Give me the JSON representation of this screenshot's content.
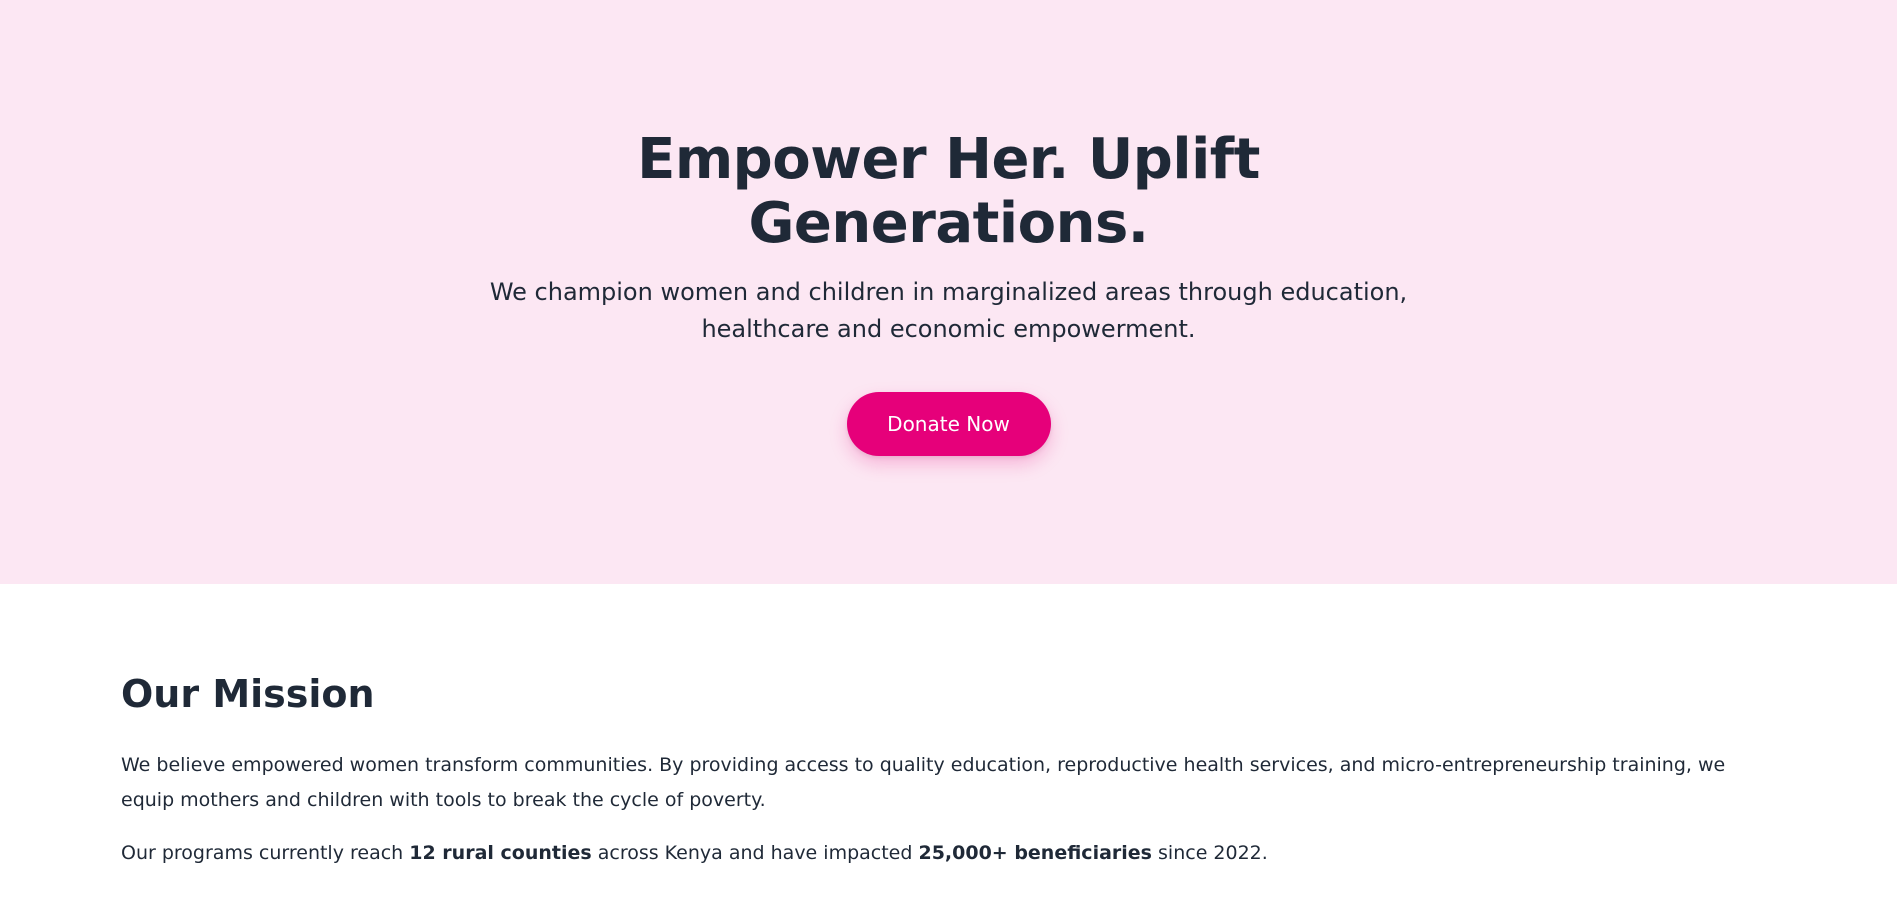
{
  "hero": {
    "title_line1": "Empower Her. Uplift",
    "title_line2": "Generations.",
    "subtitle_line1": "We champion women and children in marginalized areas through education,",
    "subtitle_line2": "healthcare and economic empowerment.",
    "donate_label": "Donate Now"
  },
  "mission": {
    "title": "Our Mission",
    "paragraph1": "We believe empowered women transform communities. By providing access to quality education, reproductive health services, and micro-entrepreneurship training, we equip mothers and children with tools to break the cycle of poverty.",
    "paragraph2": {
      "part1": "Our programs currently reach ",
      "bold1": "12 rural counties",
      "part2": " across Kenya and have impacted ",
      "bold2": "25,000+ beneficiaries",
      "part3": " since 2022."
    }
  },
  "colors": {
    "hero_background": "#fce7f3",
    "accent": "#e6007a",
    "text": "#1f2937"
  }
}
